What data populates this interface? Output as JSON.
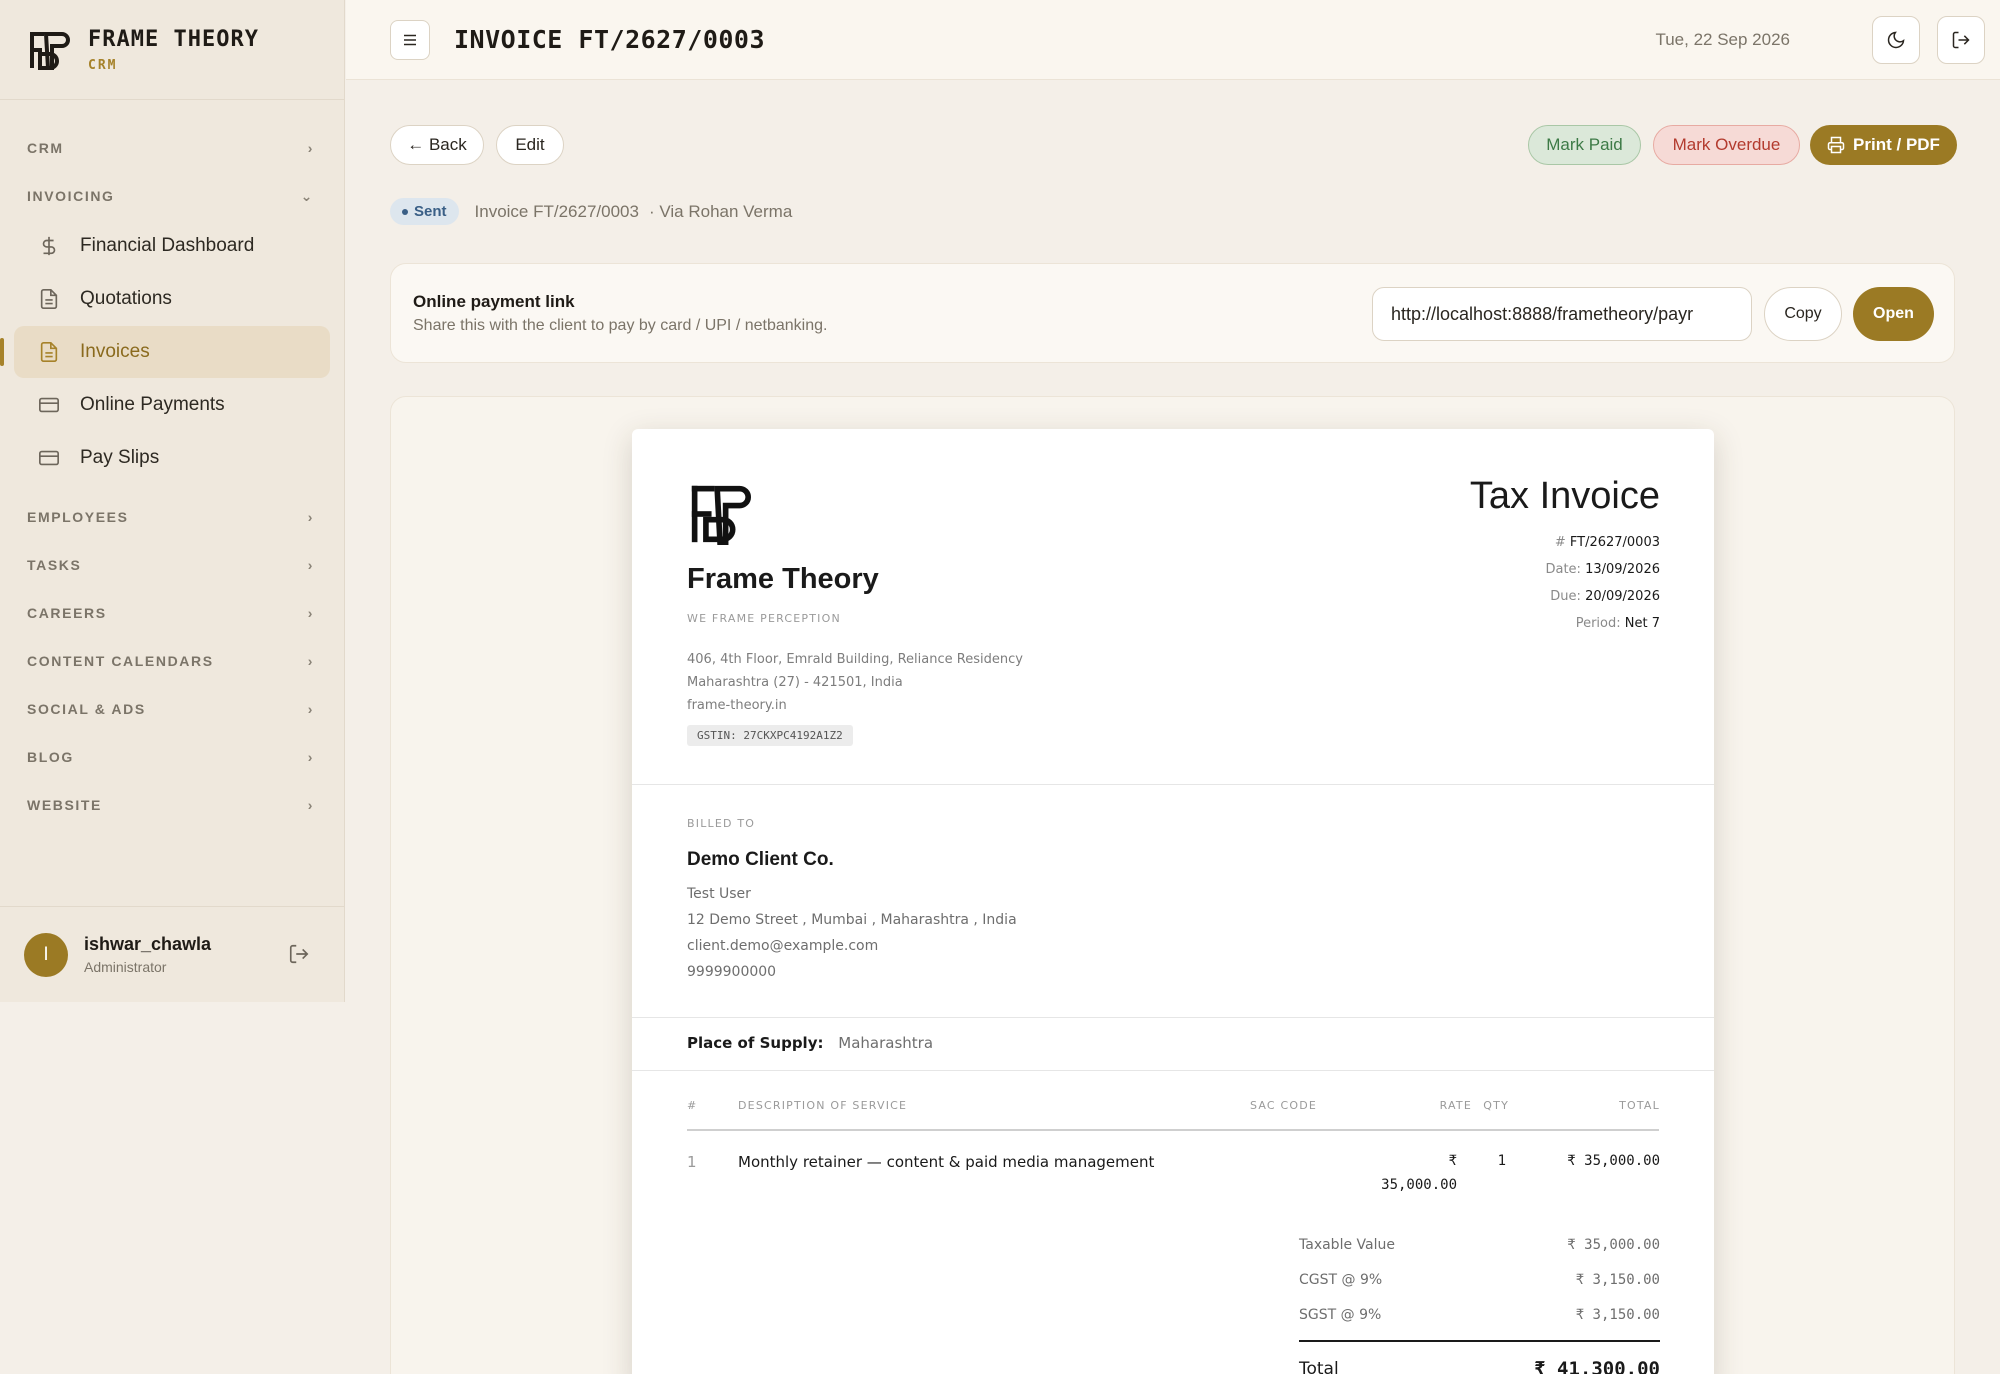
{
  "brand": {
    "name": "FRAME THEORY",
    "sub": "CRM"
  },
  "sidebar": {
    "groups": [
      {
        "label": "CRM"
      },
      {
        "label": "INVOICING"
      },
      {
        "label": "EMPLOYEES"
      },
      {
        "label": "TASKS"
      },
      {
        "label": "CAREERS"
      },
      {
        "label": "CONTENT CALENDARS"
      },
      {
        "label": "SOCIAL & ADS"
      },
      {
        "label": "BLOG"
      },
      {
        "label": "WEBSITE"
      }
    ],
    "invoicing_items": [
      {
        "label": "Financial Dashboard",
        "icon": "dollar-icon"
      },
      {
        "label": "Quotations",
        "icon": "document-icon"
      },
      {
        "label": "Invoices",
        "icon": "document-icon",
        "active": true
      },
      {
        "label": "Online Payments",
        "icon": "card-icon"
      },
      {
        "label": "Pay Slips",
        "icon": "card-icon"
      }
    ],
    "user": {
      "initial": "I",
      "name": "ishwar_chawla",
      "role": "Administrator"
    }
  },
  "topbar": {
    "title": "INVOICE FT/2627/0003",
    "date": "Tue, 22 Sep 2026"
  },
  "actions": {
    "back": "← Back",
    "edit": "Edit",
    "mark_paid": "Mark Paid",
    "mark_overdue": "Mark Overdue",
    "print": "Print / PDF"
  },
  "status": {
    "badge": "Sent",
    "invoice_ref": "Invoice FT/2627/0003",
    "via": "· Via Rohan Verma"
  },
  "payment_link": {
    "title": "Online payment link",
    "subtitle": "Share this with the client to pay by card / UPI / netbanking.",
    "url": "http://localhost:8888/frametheory/payr",
    "copy": "Copy",
    "open": "Open"
  },
  "invoice": {
    "company": "Frame Theory",
    "tagline": "WE FRAME PERCEPTION",
    "address_1": "406, 4th Floor, Emrald Building, Reliance Residency",
    "address_2": "Maharashtra (27) - 421501, India",
    "website": "frame-theory.in",
    "gstin": "GSTIN: 27CKXPC4192A1Z2",
    "title": "Tax Invoice",
    "number_label": "#",
    "number": "FT/2627/0003",
    "date_label": "Date:",
    "date": "13/09/2026",
    "due_label": "Due:",
    "due": "20/09/2026",
    "period_label": "Period:",
    "period": "Net 7",
    "billed_to_label": "BILLED TO",
    "client": {
      "name": "Demo Client Co.",
      "contact": "Test User",
      "address": "12 Demo Street , Mumbai , Maharashtra , India",
      "email": "client.demo@example.com",
      "phone": "9999900000"
    },
    "place_of_supply_label": "Place of Supply:",
    "place_of_supply": "Maharashtra",
    "columns": {
      "num": "#",
      "desc": "DESCRIPTION OF SERVICE",
      "sac": "SAC CODE",
      "rate": "RATE",
      "qty": "QTY",
      "total": "TOTAL"
    },
    "items": [
      {
        "num": "1",
        "desc": "Monthly retainer — content & paid media management",
        "sac": "",
        "rate_currency": "₹",
        "rate_value": "35,000.00",
        "qty": "1",
        "total": "₹ 35,000.00"
      }
    ],
    "totals": {
      "taxable_label": "Taxable Value",
      "taxable": "₹ 35,000.00",
      "cgst_label": "CGST @ 9%",
      "cgst": "₹ 3,150.00",
      "sgst_label": "SGST @ 9%",
      "sgst": "₹ 3,150.00",
      "total_label": "Total",
      "total": "₹ 41,300.00"
    }
  }
}
